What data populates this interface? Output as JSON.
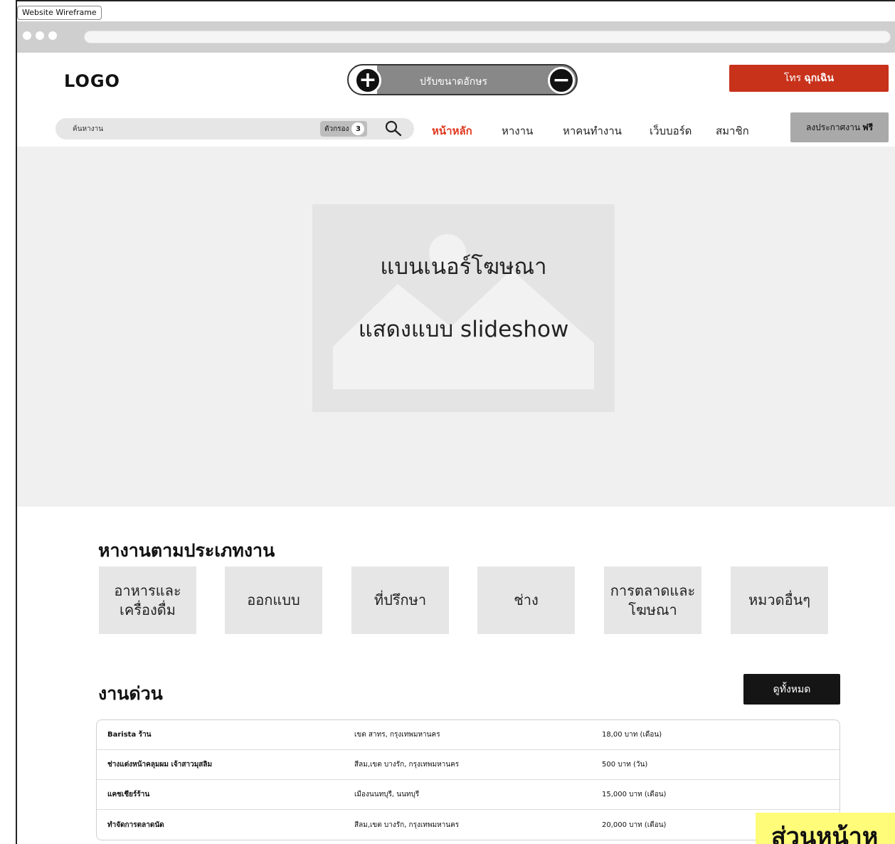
{
  "frame": {
    "title": "Website Wireframe"
  },
  "header": {
    "logo": "LOGO",
    "font_size_label": "ปรับขนาดอักษร",
    "emergency_prefix": "โทร",
    "emergency_bold": "ฉุกเฉิน"
  },
  "nav": {
    "search_placeholder": "ค้นหางาน",
    "filter_label": "ตัวกรอง",
    "filter_count": "3",
    "items": [
      "หน้าหลัก",
      "หางาน",
      "หาคนทำงาน",
      "เว็บบอร์ด",
      "สมาชิก"
    ],
    "active_index": 0,
    "post_job_label": "ลงประกาศงาน",
    "post_job_bold": "ฟรี"
  },
  "hero": {
    "banner_line1": "แบนเนอร์โฆษณา",
    "banner_line2": "แสดงแบบ slideshow"
  },
  "categories": {
    "title": "หางานตามประเภทงาน",
    "items": [
      "อาหารและเครื่องดื่ม",
      "ออกแบบ",
      "ที่ปรึกษา",
      "ช่าง",
      "การตลาดและโฆษณา",
      "หมวดอื่นๆ"
    ]
  },
  "urgent_jobs": {
    "title": "งานด่วน",
    "view_all_label": "ดูทั้งหมด",
    "rows": [
      {
        "title": "Barista ร้าน",
        "location": "เขต สาทร, กรุงเทพมหานคร",
        "salary": "18,00 บาท (เดือน)"
      },
      {
        "title": "ช่างแต่งหน้าคลุมผม เจ้าสาวมุสลิม",
        "location": "สีลม,เขต บางรัก, กรุงเทพมหานคร",
        "salary": "500 บาท (วัน)"
      },
      {
        "title": "แคชเชียร์ร้าน",
        "location": "เมืองนนทบุรี, นนทบุรี",
        "salary": "15,000 บาท (เดือน)"
      },
      {
        "title": "ทำจัดการตลาดนัด",
        "location": "สีลม,เขต บางรัก, กรุงเทพมหานคร",
        "salary": "20,000 บาท (เดือน)"
      }
    ]
  },
  "caption": {
    "text": "ส่วนหน้าห"
  },
  "colors": {
    "accent": "#c8321b",
    "active_nav": "#e0391f",
    "caption_bg": "#fffc7a"
  }
}
